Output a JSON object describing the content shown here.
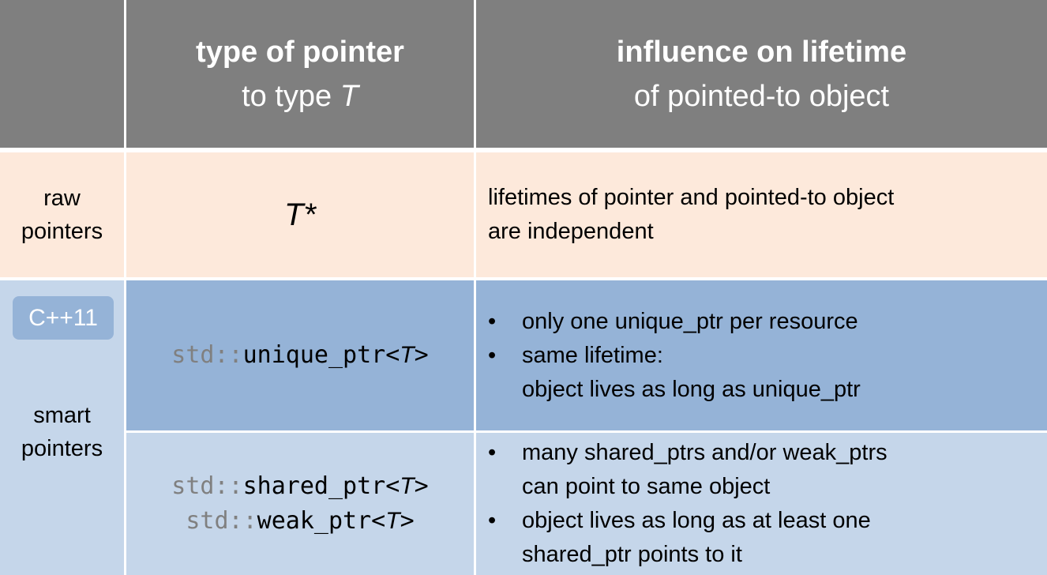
{
  "header": {
    "col2_bold": "type of pointer",
    "col2_sub_prefix": "to type ",
    "col2_sub_T": "T",
    "col3_bold": "influence on lifetime",
    "col3_sub": "of pointed-to object"
  },
  "raw": {
    "label_line1": "raw",
    "label_line2": "pointers",
    "type": "T*",
    "desc_line1": "lifetimes of pointer and pointed-to object",
    "desc_line2": "are independent"
  },
  "smart": {
    "badge": "C++11",
    "label_line1": "smart",
    "label_line2": "pointers",
    "unique": {
      "ns": "std::",
      "name": "unique_ptr<",
      "T": "T",
      "close": ">",
      "bullets": [
        {
          "line1": "only one unique_ptr per resource",
          "line2": ""
        },
        {
          "line1": "same lifetime:",
          "line2": "object lives as long as unique_ptr"
        }
      ]
    },
    "shared": {
      "shared_ns": "std::",
      "shared_name": "shared_ptr<",
      "shared_T": "T",
      "shared_close": ">",
      "weak_ns": "std::",
      "weak_name": "weak_ptr<",
      "weak_T": "T",
      "weak_close": ">",
      "bullets": [
        {
          "line1": "many shared_ptrs and/or weak_ptrs",
          "line2": "can point to same object"
        },
        {
          "line1": "object lives as long as at least one",
          "line2": "shared_ptr points to it"
        }
      ]
    }
  }
}
